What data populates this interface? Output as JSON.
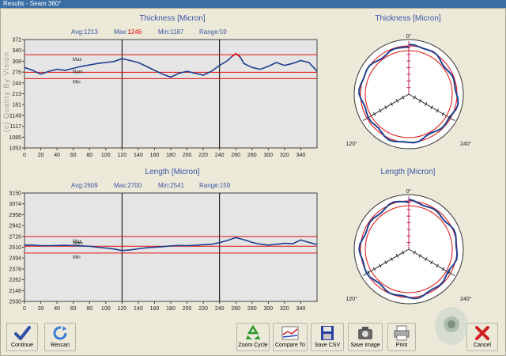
{
  "window": {
    "title": "Results - Seam 360°"
  },
  "watermark": "(c) Quality By Vision",
  "thickness_plot": {
    "title": "Thickness [Micron]",
    "stats": {
      "avg_label": "Avg:",
      "avg": "1213",
      "max_label": "Max:",
      "max": "1246",
      "min_label": "Min:",
      "min": "1187",
      "range_label": "Range:",
      "range": "59"
    },
    "limit_labels": {
      "max": "Max",
      "nom": "Nom",
      "min": "Min"
    }
  },
  "thickness_polar": {
    "title": "Thickness [Micron]"
  },
  "length_plot": {
    "title": "Length [Micron]",
    "stats": {
      "avg_label": "Avg:",
      "avg": "2609",
      "max_label": "Max:",
      "max": "2700",
      "min_label": "Min:",
      "min": "2541",
      "range_label": "Range:",
      "range": "159"
    },
    "limit_labels": {
      "max": "Max",
      "nom": "Nom",
      "min": "Min"
    }
  },
  "length_polar": {
    "title": "Length [Micron]"
  },
  "polar_labels": {
    "top": "0°",
    "left": "120°",
    "right": "240°"
  },
  "toolbar": {
    "continue": "Continue",
    "rescan": "Rescan",
    "zoom_cycle": "Zoom Cycle",
    "compare_to": "Compare To",
    "save_csv": "Save CSV",
    "save_image": "Save Image",
    "print": "Print",
    "cancel": "Cancel"
  },
  "colors": {
    "plot_bg": "#e5e5e5",
    "trace": "#1f3f8f",
    "limit": "#e01010",
    "title_blue": "#3a57a8"
  },
  "chart_data": [
    {
      "type": "line",
      "title": "Thickness [Micron]",
      "xlim": [
        0,
        360
      ],
      "x_ticks": [
        0,
        20,
        40,
        60,
        80,
        100,
        120,
        140,
        160,
        180,
        200,
        220,
        240,
        260,
        280,
        300,
        320,
        340
      ],
      "ylim": [
        1053,
        372
      ],
      "y_ticks": [
        "372",
        "340",
        "308",
        "276",
        "244",
        "213",
        "181",
        "1149",
        "1117",
        "1085",
        "1053"
      ],
      "limits": {
        "max": 1244,
        "nom": 1208,
        "min": 1195
      },
      "x": [
        0,
        10,
        20,
        30,
        40,
        50,
        60,
        70,
        80,
        90,
        100,
        110,
        120,
        130,
        140,
        150,
        160,
        170,
        180,
        190,
        200,
        210,
        220,
        230,
        240,
        250,
        255,
        260,
        265,
        270,
        280,
        290,
        300,
        310,
        320,
        330,
        340,
        350,
        360
      ],
      "y": [
        1218,
        1212,
        1204,
        1210,
        1214,
        1212,
        1216,
        1220,
        1223,
        1226,
        1228,
        1230,
        1236,
        1232,
        1228,
        1220,
        1212,
        1204,
        1198,
        1206,
        1210,
        1206,
        1202,
        1210,
        1222,
        1232,
        1240,
        1246,
        1240,
        1226,
        1218,
        1214,
        1220,
        1228,
        1222,
        1226,
        1232,
        1228,
        1210
      ]
    },
    {
      "type": "line",
      "title": "Length [Micron]",
      "xlim": [
        0,
        360
      ],
      "x_ticks": [
        0,
        20,
        40,
        60,
        80,
        100,
        120,
        140,
        160,
        180,
        200,
        220,
        240,
        260,
        280,
        300,
        320,
        340
      ],
      "ylim": [
        2030,
        3150
      ],
      "y_ticks": [
        2030,
        2146,
        2262,
        2378,
        2494,
        2610,
        2726,
        2842,
        2958,
        3074,
        3150
      ],
      "limits": {
        "max": 2700,
        "nom": 2600,
        "min": 2530
      },
      "x": [
        0,
        10,
        20,
        30,
        40,
        50,
        60,
        70,
        80,
        90,
        100,
        110,
        120,
        130,
        140,
        150,
        160,
        170,
        180,
        190,
        200,
        210,
        220,
        230,
        240,
        250,
        260,
        270,
        280,
        290,
        300,
        310,
        320,
        330,
        340,
        350,
        360
      ],
      "y": [
        2612,
        2612,
        2606,
        2606,
        2608,
        2610,
        2606,
        2604,
        2600,
        2590,
        2582,
        2572,
        2556,
        2562,
        2574,
        2584,
        2590,
        2596,
        2604,
        2608,
        2606,
        2610,
        2616,
        2620,
        2638,
        2660,
        2690,
        2668,
        2640,
        2622,
        2612,
        2620,
        2630,
        2626,
        2664,
        2640,
        2618
      ]
    }
  ]
}
